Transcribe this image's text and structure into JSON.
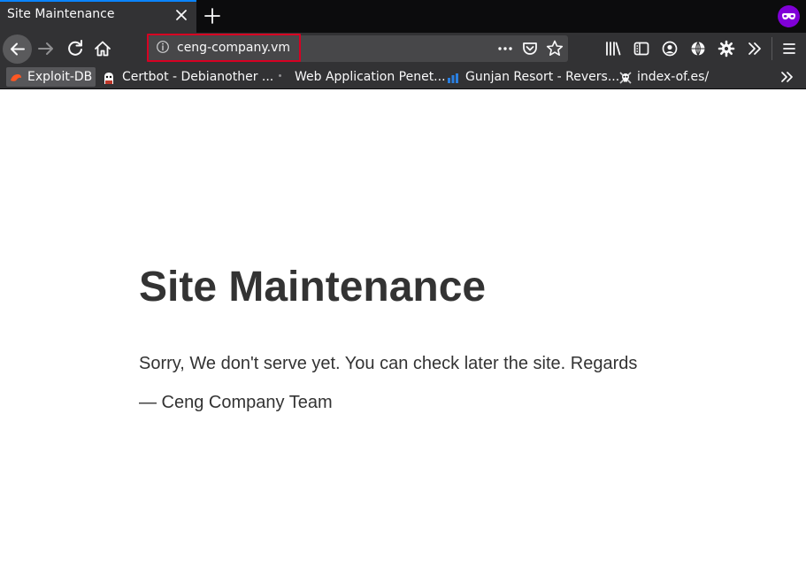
{
  "tab": {
    "title": "Site Maintenance"
  },
  "urlbar": {
    "url": "ceng-company.vm"
  },
  "bookmarks": [
    {
      "label": "Exploit-DB"
    },
    {
      "label": "Certbot - Debianother ..."
    },
    {
      "label": "Web Application Penet..."
    },
    {
      "label": "Gunjan Resort - Revers..."
    },
    {
      "label": "index-of.es/"
    }
  ],
  "page": {
    "title": "Site Maintenance",
    "message": "Sorry, We don't serve yet. You can check later the site. Regards",
    "signature": "— Ceng Company Team"
  },
  "colors": {
    "chrome_dark": "#0c0c0d",
    "toolbar": "#323234",
    "urlbar": "#474749",
    "highlight_border": "#d70022",
    "private_badge": "#8000d7",
    "text": "#333333"
  },
  "icons": [
    "close-icon",
    "plus-icon",
    "private-browsing-icon",
    "back-arrow-icon",
    "forward-arrow-icon",
    "reload-icon",
    "home-icon",
    "info-icon",
    "more-dots-icon",
    "pocket-icon",
    "star-icon",
    "library-icon",
    "sidebar-icon",
    "account-icon",
    "globe-icon",
    "gear-icon",
    "chevron-double-right-icon",
    "hamburger-menu-icon",
    "exploit-db-icon",
    "certbot-icon",
    "bar-chart-icon",
    "skull-icon"
  ]
}
